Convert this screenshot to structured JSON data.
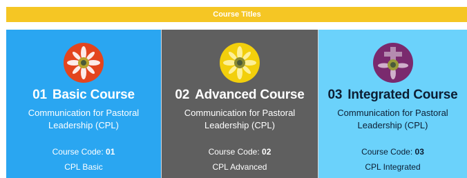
{
  "header": {
    "title": "Course Titles"
  },
  "cards": [
    {
      "number": "01",
      "title": "Basic Course",
      "subtitle": "Communication for Pastoral Leadership  (CPL)",
      "code_label": "Course Code:",
      "code_value": "01",
      "code_name": "CPL Basic",
      "background": "#2aa6f1",
      "logo_color": "#e3451e",
      "logo_icon": "flower-emblem-icon"
    },
    {
      "number": "02",
      "title": "Advanced Course",
      "subtitle": "Communication for Pastoral Leadership  (CPL)",
      "code_label": "Course Code:",
      "code_value": "02",
      "code_name": "CPL Advanced",
      "background": "#5f5f5f",
      "logo_color": "#f2cf0c",
      "logo_icon": "flower-emblem-icon"
    },
    {
      "number": "03",
      "title": "Integrated Course",
      "subtitle": "Communication for Pastoral Leadership (CPL)",
      "code_label": "Course Code:",
      "code_value": "03",
      "code_name": "CPL Integrated",
      "background": "#6bd2fb",
      "logo_color": "#7a2a6e",
      "logo_icon": "cross-emblem-icon"
    }
  ]
}
